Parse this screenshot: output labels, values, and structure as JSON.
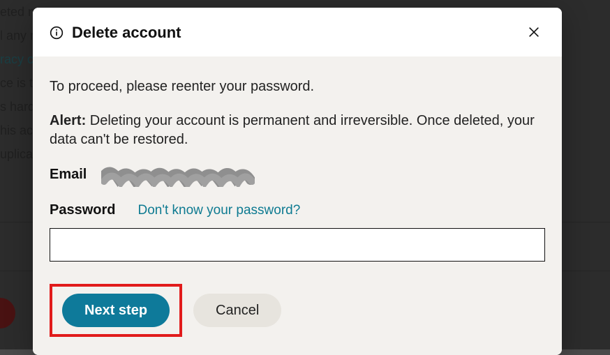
{
  "background": {
    "line1": "eted n",
    "line2": "l any re",
    "line3_part": "racy co",
    "line4": "ce is to",
    "line5": "s hard",
    "line6": "his ac",
    "line7": "uplica"
  },
  "modal": {
    "title": "Delete account",
    "instruction": "To proceed, please reenter your password.",
    "alert_label": "Alert:",
    "alert_text": "Deleting your account is permanent and irreversible. Once deleted, your data can't be restored.",
    "email_label": "Email",
    "password_label": "Password",
    "forgot_pw_link": "Don't know your password?",
    "password_value": ""
  },
  "footer": {
    "next_label": "Next step",
    "cancel_label": "Cancel"
  }
}
